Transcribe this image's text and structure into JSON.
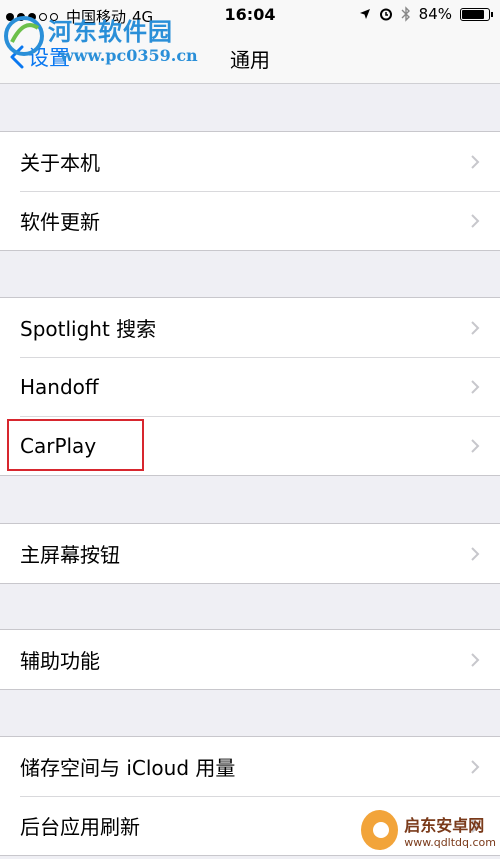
{
  "status_bar": {
    "carrier": "中国移动",
    "network": "4G",
    "time": "16:04",
    "battery_percent": "84%",
    "battery_level": 0.84
  },
  "nav": {
    "back_label": "设置",
    "title": "通用"
  },
  "watermark": {
    "title": "河东软件园",
    "url": "www.pc0359.cn",
    "bottom_name": "启东安卓网",
    "bottom_url": "www.qdltdq.com"
  },
  "groups": [
    {
      "items": [
        {
          "label": "关于本机"
        },
        {
          "label": "软件更新"
        }
      ]
    },
    {
      "items": [
        {
          "label": "Spotlight 搜索"
        },
        {
          "label": "Handoff"
        },
        {
          "label": "CarPlay"
        }
      ]
    },
    {
      "items": [
        {
          "label": "主屏幕按钮"
        }
      ]
    },
    {
      "items": [
        {
          "label": "辅助功能"
        }
      ]
    },
    {
      "items": [
        {
          "label": "储存空间与 iCloud 用量"
        },
        {
          "label": "后台应用刷新"
        }
      ]
    }
  ],
  "colors": {
    "accent": "#0a78f0",
    "highlight": "#d7262e",
    "background": "#efeff4"
  }
}
